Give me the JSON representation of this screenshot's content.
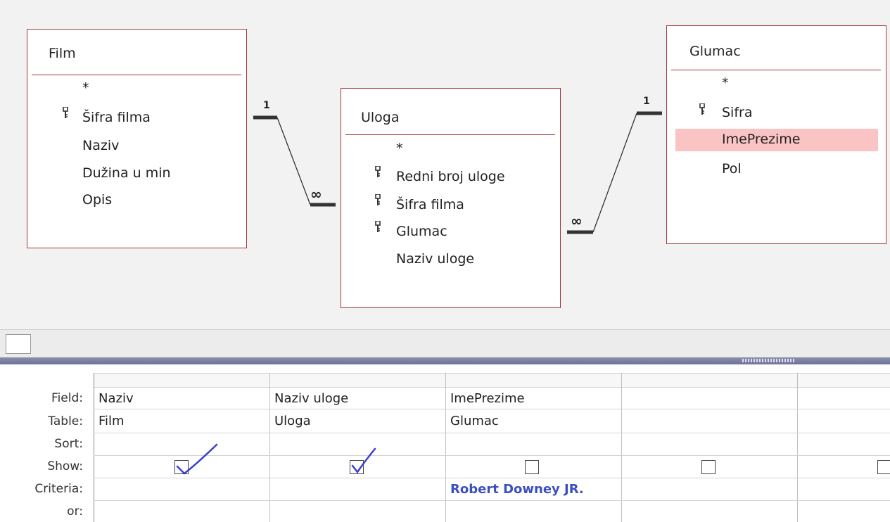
{
  "tables": {
    "film": {
      "title": "Film",
      "fields": [
        {
          "name": "*",
          "key": false
        },
        {
          "name": "Šifra filma",
          "key": true
        },
        {
          "name": "Naziv",
          "key": false
        },
        {
          "name": "Dužina u min",
          "key": false
        },
        {
          "name": "Opis",
          "key": false
        }
      ]
    },
    "uloga": {
      "title": "Uloga",
      "fields": [
        {
          "name": "*",
          "key": false
        },
        {
          "name": "Redni broj uloge",
          "key": true
        },
        {
          "name": "Šifra filma",
          "key": true
        },
        {
          "name": "Glumac",
          "key": true
        },
        {
          "name": "Naziv uloge",
          "key": false
        }
      ]
    },
    "glumac": {
      "title": "Glumac",
      "fields": [
        {
          "name": "*",
          "key": false
        },
        {
          "name": "Sifra",
          "key": true
        },
        {
          "name": "ImePrezime",
          "key": false,
          "highlighted": true
        },
        {
          "name": "Pol",
          "key": false
        }
      ]
    }
  },
  "relationships": [
    {
      "from": "Film",
      "to": "Uloga",
      "one_label": "1",
      "many_label": "∞"
    },
    {
      "from": "Glumac",
      "to": "Uloga",
      "one_label": "1",
      "many_label": "∞"
    }
  ],
  "grid": {
    "row_labels": {
      "field": "Field:",
      "table": "Table:",
      "sort": "Sort:",
      "show": "Show:",
      "criteria": "Criteria:",
      "or": "or:"
    },
    "columns": [
      {
        "field": "Naziv",
        "table": "Film",
        "show": true,
        "criteria": ""
      },
      {
        "field": "Naziv uloge",
        "table": "Uloga",
        "show": true,
        "criteria": ""
      },
      {
        "field": "ImePrezime",
        "table": "Glumac",
        "show": false,
        "criteria": "Robert Downey JR."
      },
      {
        "field": "",
        "table": "",
        "show": false,
        "criteria": ""
      },
      {
        "field": "",
        "table": "",
        "show": false,
        "criteria": ""
      }
    ]
  },
  "colors": {
    "table_border": "#a4373a",
    "highlight": "#fbc4c4",
    "criteria_text": "#3d4fbf",
    "check_mark": "#3a3fd0"
  },
  "icons": [
    "primary-key-icon",
    "check-mark-icon"
  ]
}
